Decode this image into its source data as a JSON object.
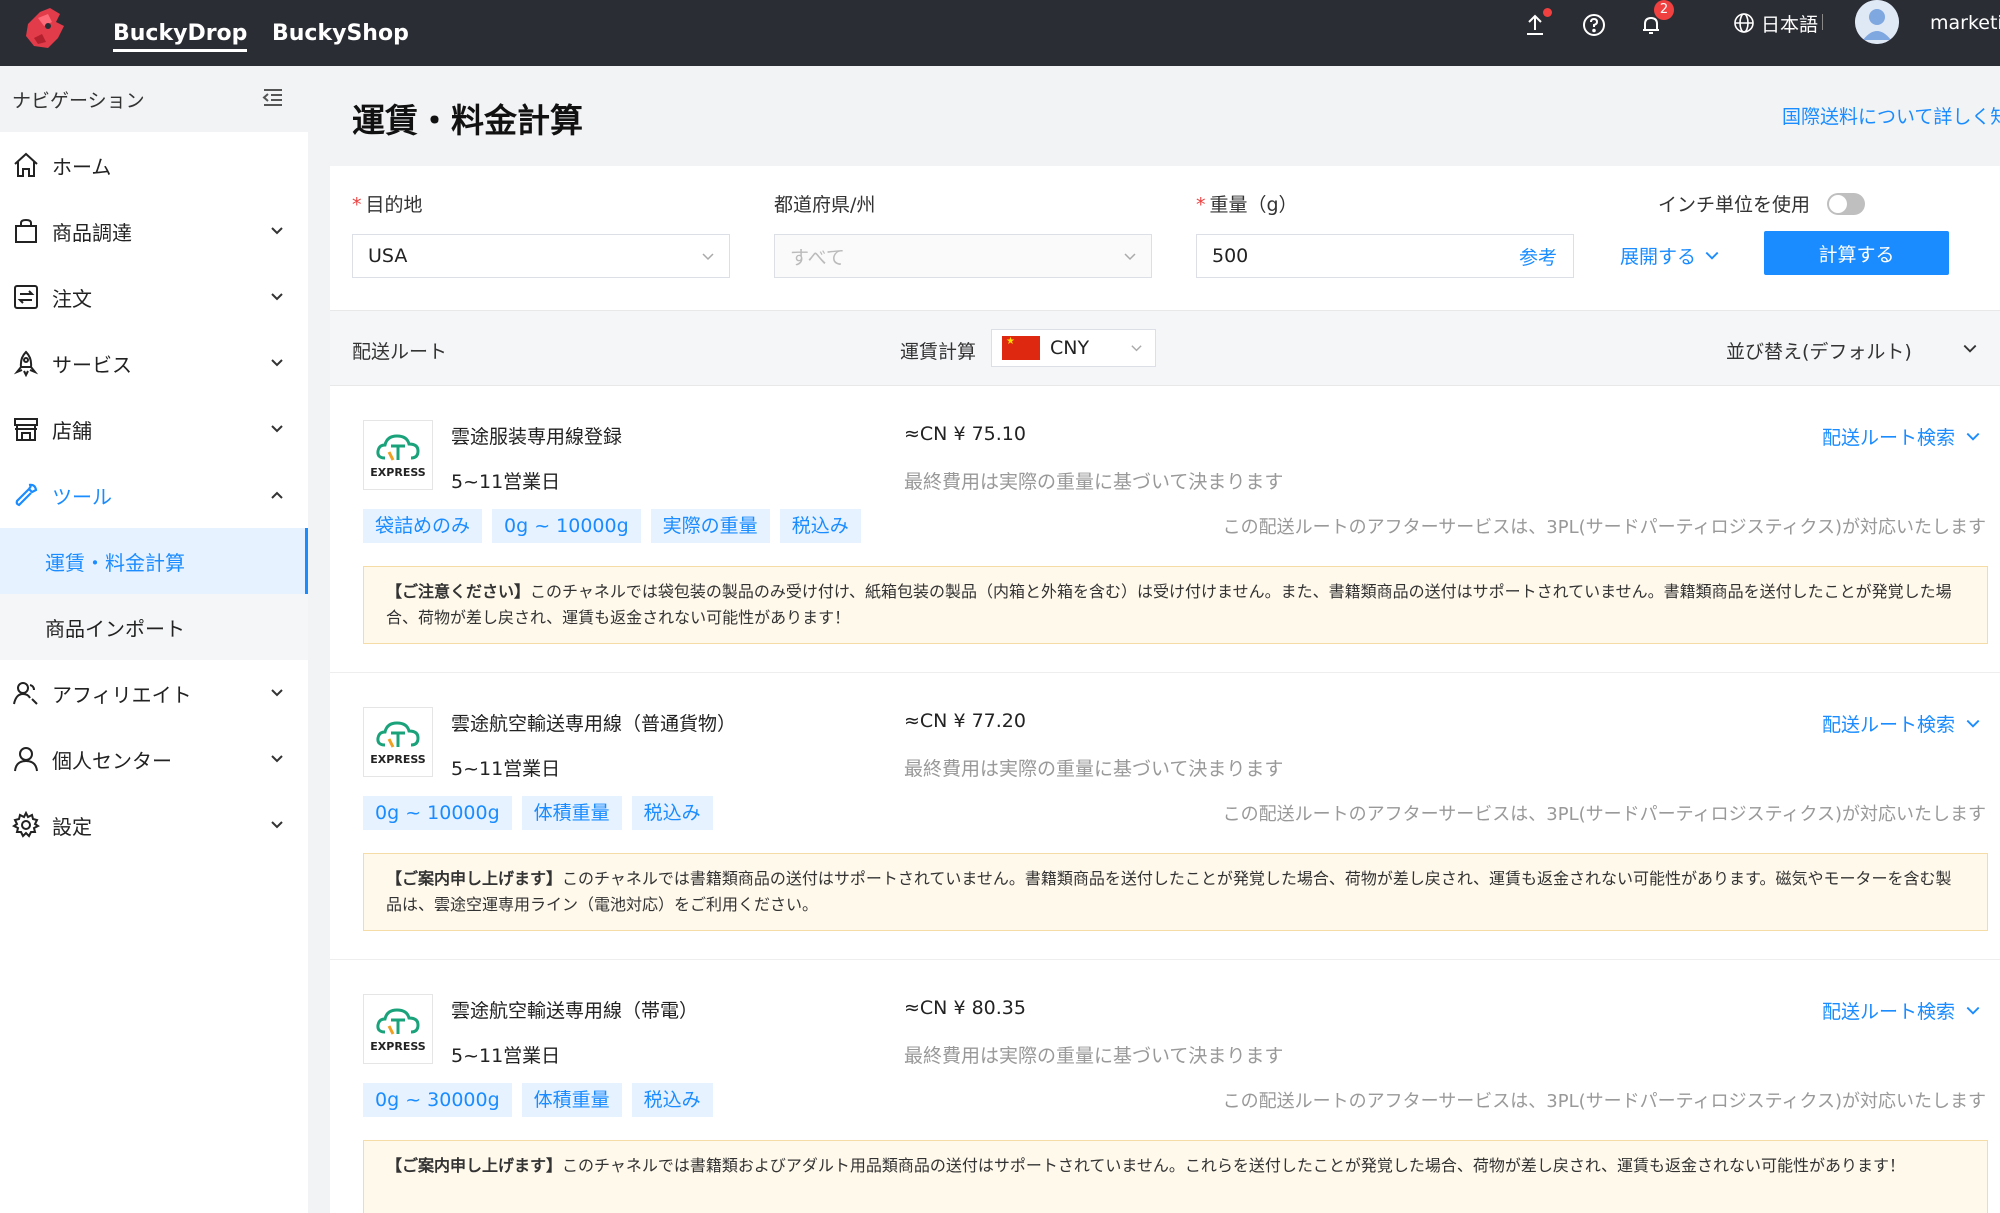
{
  "topbar": {
    "nav": [
      "BuckyDrop",
      "BuckyShop"
    ],
    "notifications_count": "2",
    "language": "日本語",
    "username": "marketi"
  },
  "sidebar": {
    "header": "ナビゲーション",
    "items": [
      {
        "label": "ホーム",
        "icon": "home-icon"
      },
      {
        "label": "商品調達",
        "icon": "shopping-bag-icon"
      },
      {
        "label": "注文",
        "icon": "order-icon"
      },
      {
        "label": "サービス",
        "icon": "rocket-icon"
      },
      {
        "label": "店舗",
        "icon": "store-icon"
      },
      {
        "label": "ツール",
        "icon": "wrench-icon"
      },
      {
        "label": "アフィリエイト",
        "icon": "affiliate-icon"
      },
      {
        "label": "個人センター",
        "icon": "user-icon"
      },
      {
        "label": "設定",
        "icon": "gear-icon"
      }
    ],
    "sub_items": [
      "運賃・料金計算",
      "商品インポート"
    ]
  },
  "page": {
    "title": "運賃・料金計算",
    "info_link": "国際送料について詳しく知"
  },
  "form": {
    "destination_label": "目的地",
    "destination_value": "USA",
    "state_label": "都道府県/州",
    "state_placeholder": "すべて",
    "weight_label": "重量（g）",
    "weight_value": "500",
    "weight_ref": "参考",
    "inch_label": "インチ単位を使用",
    "expand_label": "展開する",
    "calc_button": "計算する"
  },
  "sortbar": {
    "route_label": "配送ルート",
    "fare_label": "運賃計算",
    "currency": "CNY",
    "sort_label": "並び替え(デフォルト)"
  },
  "routes": [
    {
      "logo_text": "EXPRESS",
      "name": "雲途服装専用線登録",
      "days": "5~11営業日",
      "price": "≈CN ¥ 75.10",
      "price_note": "最終費用は実際の重量に基づいて決まります",
      "search_label": "配送ルート検索",
      "tags": [
        "袋詰めのみ",
        "0g ~ 10000g",
        "実際の重量",
        "税込み"
      ],
      "after_service": "この配送ルートのアフターサービスは、3PL(サードパーティロジスティクス)が対応いたします",
      "notice_title": "【ご注意ください】",
      "notice_text": "このチャネルでは袋包装の製品のみ受け付け、紙箱包装の製品（内箱と外箱を含む）は受け付けません。また、書籍類商品の送付はサポートされていません。書籍類商品を送付したことが発覚した場合、荷物が差し戻され、運賃も返金されない可能性があります！"
    },
    {
      "logo_text": "EXPRESS",
      "name": "雲途航空輸送専用線（普通貨物）",
      "days": "5~11営業日",
      "price": "≈CN ¥ 77.20",
      "price_note": "最終費用は実際の重量に基づいて決まります",
      "search_label": "配送ルート検索",
      "tags": [
        "0g ~ 10000g",
        "体積重量",
        "税込み"
      ],
      "after_service": "この配送ルートのアフターサービスは、3PL(サードパーティロジスティクス)が対応いたします",
      "notice_title": "【ご案内申し上げます】",
      "notice_text": "このチャネルでは書籍類商品の送付はサポートされていません。書籍類商品を送付したことが発覚した場合、荷物が差し戻され、運賃も返金されない可能性があります。磁気やモーターを含む製品は、雲途空運専用ライン（電池対応）をご利用ください。"
    },
    {
      "logo_text": "EXPRESS",
      "name": "雲途航空輸送専用線（帯電）",
      "days": "5~11営業日",
      "price": "≈CN ¥ 80.35",
      "price_note": "最終費用は実際の重量に基づいて決まります",
      "search_label": "配送ルート検索",
      "tags": [
        "0g ~ 30000g",
        "体積重量",
        "税込み"
      ],
      "after_service": "この配送ルートのアフターサービスは、3PL(サードパーティロジスティクス)が対応いたします",
      "notice_title": "【ご案内申し上げます】",
      "notice_text": "このチャネルでは書籍類およびアダルト用品類商品の送付はサポートされていません。これらを送付したことが発覚した場合、荷物が差し戻され、運賃も返金されない可能性があります！"
    }
  ],
  "colors": {
    "accent": "#1a8cff",
    "topbar": "#2b2d34",
    "notice_bg": "#fff9ec",
    "badge": "#f04040"
  }
}
